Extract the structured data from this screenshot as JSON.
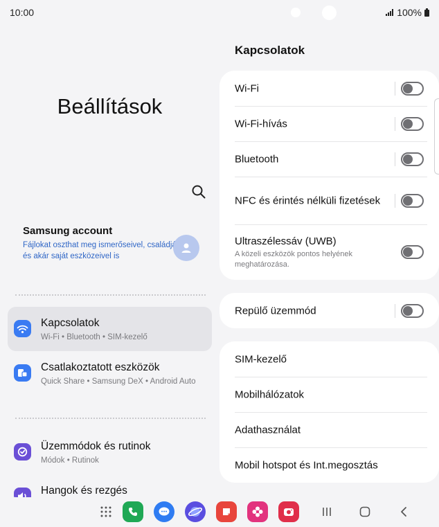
{
  "status_bar": {
    "time": "10:00",
    "battery": "100%"
  },
  "left": {
    "title": "Beállítások",
    "account": {
      "name": "Samsung account",
      "description": "Fájlokat oszthat meg ismerőseivel, családjával és akár saját eszközeivel is"
    },
    "menu": [
      {
        "title": "Kapcsolatok",
        "subtitle": "Wi-Fi  •  Bluetooth  •  SIM-kezelő",
        "icon": "wifi-icon",
        "color": "#3a7bf2"
      },
      {
        "title": "Csatlakoztatott eszközök",
        "subtitle": "Quick Share  •  Samsung DeX  •  Android Auto",
        "icon": "devices-icon",
        "color": "#3a7bf2"
      },
      {
        "title": "Üzemmódok és rutinok",
        "subtitle": "Módok  •  Rutinok",
        "icon": "modes-icon",
        "color": "#6a4fd6"
      },
      {
        "title": "Hangok és rezgés",
        "subtitle": "",
        "icon": "sound-icon",
        "color": "#6a4fd6"
      }
    ]
  },
  "right": {
    "title": "Kapcsolatok",
    "wifi": "Wi-Fi",
    "wifi_calling": "Wi-Fi-hívás",
    "bluetooth": "Bluetooth",
    "nfc": "NFC és érintés nélküli fizetések",
    "uwb": "Ultraszélessáv (UWB)",
    "uwb_sub": "A közeli eszközök pontos helyének meghatározása.",
    "airplane": "Repülő üzemmód",
    "sim": "SIM-kezelő",
    "mobile_networks": "Mobilhálózatok",
    "data_usage": "Adathasználat",
    "hotspot": "Mobil hotspot és Int.megosztás",
    "toggles": {
      "wifi": false,
      "wifi_calling": false,
      "bluetooth": false,
      "nfc": false,
      "uwb": false,
      "airplane": false
    }
  },
  "dock": {
    "apps": [
      "apps-grid-icon",
      "phone-icon",
      "messages-icon",
      "internet-icon",
      "notes-icon",
      "gallery-icon",
      "camera-icon"
    ],
    "nav": [
      "recents-icon",
      "home-icon",
      "back-icon"
    ]
  }
}
